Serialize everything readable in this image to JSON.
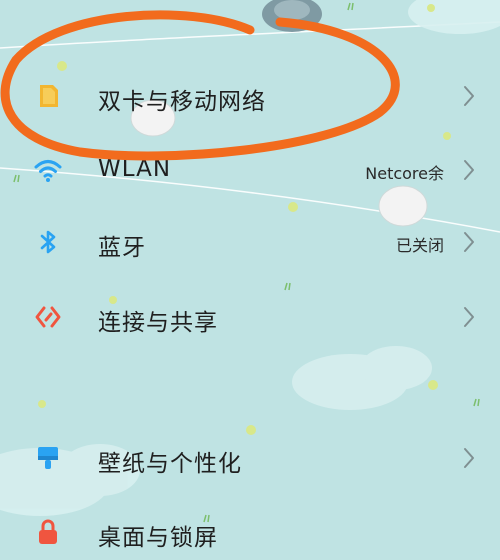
{
  "settings": {
    "items": [
      {
        "label": "双卡与移动网络",
        "value": "",
        "icon": "sim-card-icon",
        "color": "#f2b631"
      },
      {
        "label": "WLAN",
        "value": "Netcore余",
        "icon": "wifi-icon",
        "color": "#2aa3f2"
      },
      {
        "label": "蓝牙",
        "value": "已关闭",
        "icon": "bluetooth-icon",
        "color": "#2aa3f2"
      },
      {
        "label": "连接与共享",
        "value": "",
        "icon": "share-icon",
        "color": "#f0553f"
      },
      {
        "label": "壁纸与个性化",
        "value": "",
        "icon": "brush-icon",
        "color": "#2aa3f2"
      },
      {
        "label": "桌面与锁屏",
        "value": "",
        "icon": "lock-icon",
        "color": "#f0553f"
      }
    ]
  },
  "colors": {
    "background": "#bfe3e3",
    "annotation": "#f26b1d"
  }
}
